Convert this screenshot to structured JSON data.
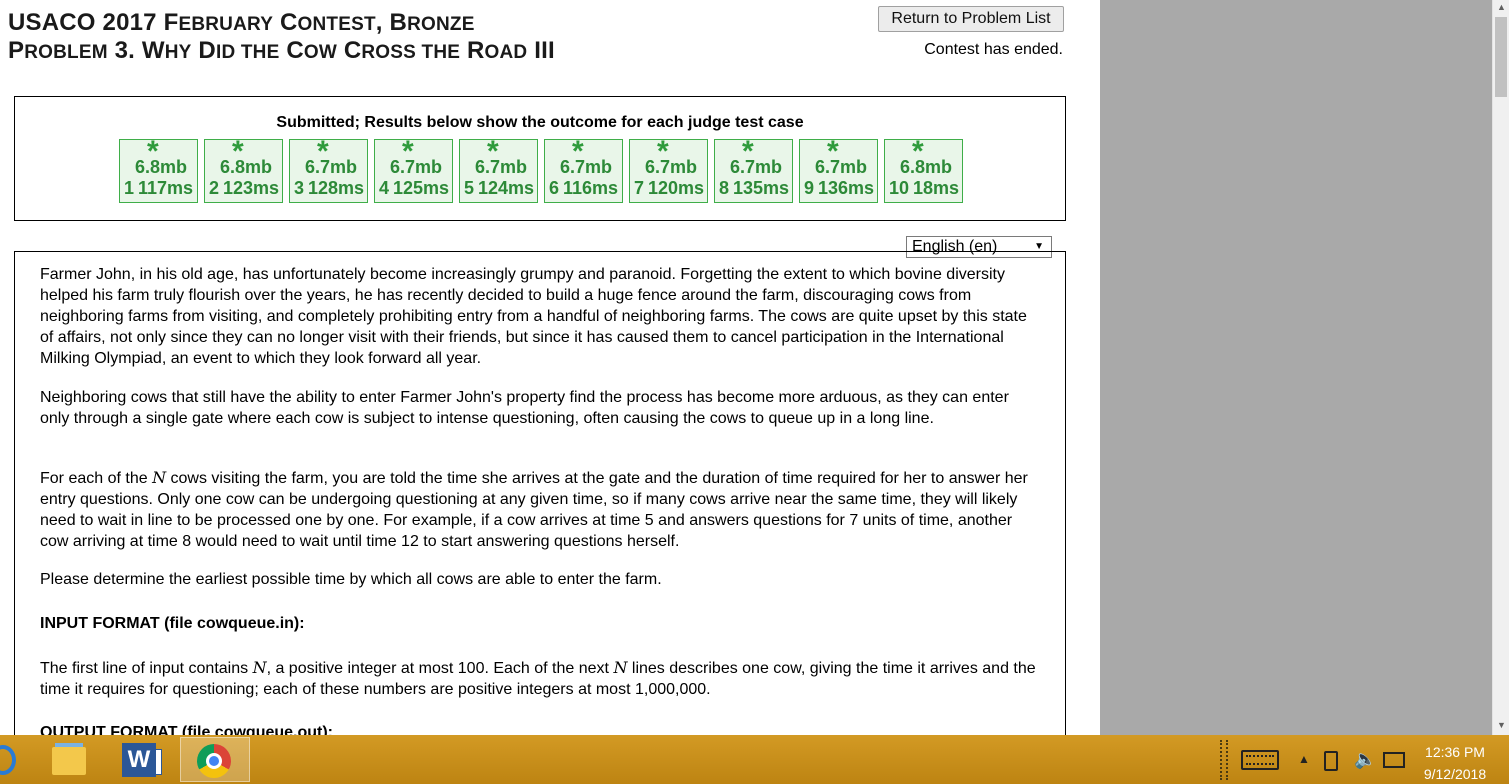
{
  "title": {
    "line1": [
      {
        "text": "USACO 2017 F",
        "sc": false
      },
      {
        "text": "EBRUARY",
        "sc": true
      },
      {
        "text": " C",
        "sc": false
      },
      {
        "text": "ONTEST",
        "sc": true
      },
      {
        "text": ", B",
        "sc": false
      },
      {
        "text": "RONZE",
        "sc": true
      }
    ],
    "line2": [
      {
        "text": "P",
        "sc": false
      },
      {
        "text": "ROBLEM",
        "sc": true
      },
      {
        "text": " 3. W",
        "sc": false
      },
      {
        "text": "HY",
        "sc": true
      },
      {
        "text": " D",
        "sc": false
      },
      {
        "text": "ID THE",
        "sc": true
      },
      {
        "text": " C",
        "sc": false
      },
      {
        "text": "OW",
        "sc": true
      },
      {
        "text": " C",
        "sc": false
      },
      {
        "text": "ROSS THE",
        "sc": true
      },
      {
        "text": " R",
        "sc": false
      },
      {
        "text": "OAD",
        "sc": true
      },
      {
        "text": " III",
        "sc": false
      }
    ]
  },
  "return_button": "Return to Problem List",
  "contest_status": "Contest has ended.",
  "results": {
    "heading": "Submitted; Results below show the outcome for each judge test case",
    "tests": [
      {
        "num": "1",
        "mem": "6.8mb",
        "time": "117ms"
      },
      {
        "num": "2",
        "mem": "6.8mb",
        "time": "123ms"
      },
      {
        "num": "3",
        "mem": "6.7mb",
        "time": "128ms"
      },
      {
        "num": "4",
        "mem": "6.7mb",
        "time": "125ms"
      },
      {
        "num": "5",
        "mem": "6.7mb",
        "time": "124ms"
      },
      {
        "num": "6",
        "mem": "6.7mb",
        "time": "116ms"
      },
      {
        "num": "7",
        "mem": "6.7mb",
        "time": "120ms"
      },
      {
        "num": "8",
        "mem": "6.7mb",
        "time": "135ms"
      },
      {
        "num": "9",
        "mem": "6.7mb",
        "time": "136ms"
      },
      {
        "num": "10",
        "mem": "6.8mb",
        "time": "18ms"
      }
    ],
    "status_symbol": "*",
    "pass_color": "#2e9b3b"
  },
  "language_select": {
    "selected": "English (en)"
  },
  "statement": {
    "p1": "Farmer John, in his old age, has unfortunately become increasingly grumpy and paranoid. Forgetting the extent to which bovine diversity helped his farm truly flourish over the years, he has recently decided to build a huge fence around the farm, discouraging cows from neighboring farms from visiting, and completely prohibiting entry from a handful of neighboring farms. The cows are quite upset by this state of affairs, not only since they can no longer visit with their friends, but since it has caused them to cancel participation in the International Milking Olympiad, an event to which they look forward all year.",
    "p2": "Neighboring cows that still have the ability to enter Farmer John's property find the process has become more arduous, as they can enter only through a single gate where each cow is subject to intense questioning, often causing the cows to queue up in a long line.",
    "p3_pre": "For each of the ",
    "var_n": "N",
    "p3_post": " cows visiting the farm, you are told the time she arrives at the gate and the duration of time required for her to answer her entry questions. Only one cow can be undergoing questioning at any given time, so if many cows arrive near the same time, they will likely need to wait in line to be processed one by one. For example, if a cow arrives at time 5 and answers questions for 7 units of time, another cow arriving at time 8 would need to wait until time 12 to start answering questions herself.",
    "p4": "Please determine the earliest possible time by which all cows are able to enter the farm.",
    "input_heading": "INPUT FORMAT (file cowqueue.in):",
    "p5_pre": "The first line of input contains ",
    "p5_mid": ", a positive integer at most 100. Each of the next ",
    "p5_post": " lines describes one cow, giving the time it arrives and the time it requires for questioning; each of these numbers are positive integers at most 1,000,000.",
    "output_heading": "OUTPUT FORMAT (file cowqueue.out):"
  },
  "taskbar": {
    "clock_time": "12:36 PM",
    "clock_date": "9/12/2018",
    "word_letter": "W",
    "icons": [
      "start-icon",
      "file-explorer-icon",
      "word-icon",
      "chrome-icon",
      "keyboard-icon",
      "tray-expand-icon",
      "battery-icon",
      "volume-icon",
      "network-icon"
    ]
  }
}
